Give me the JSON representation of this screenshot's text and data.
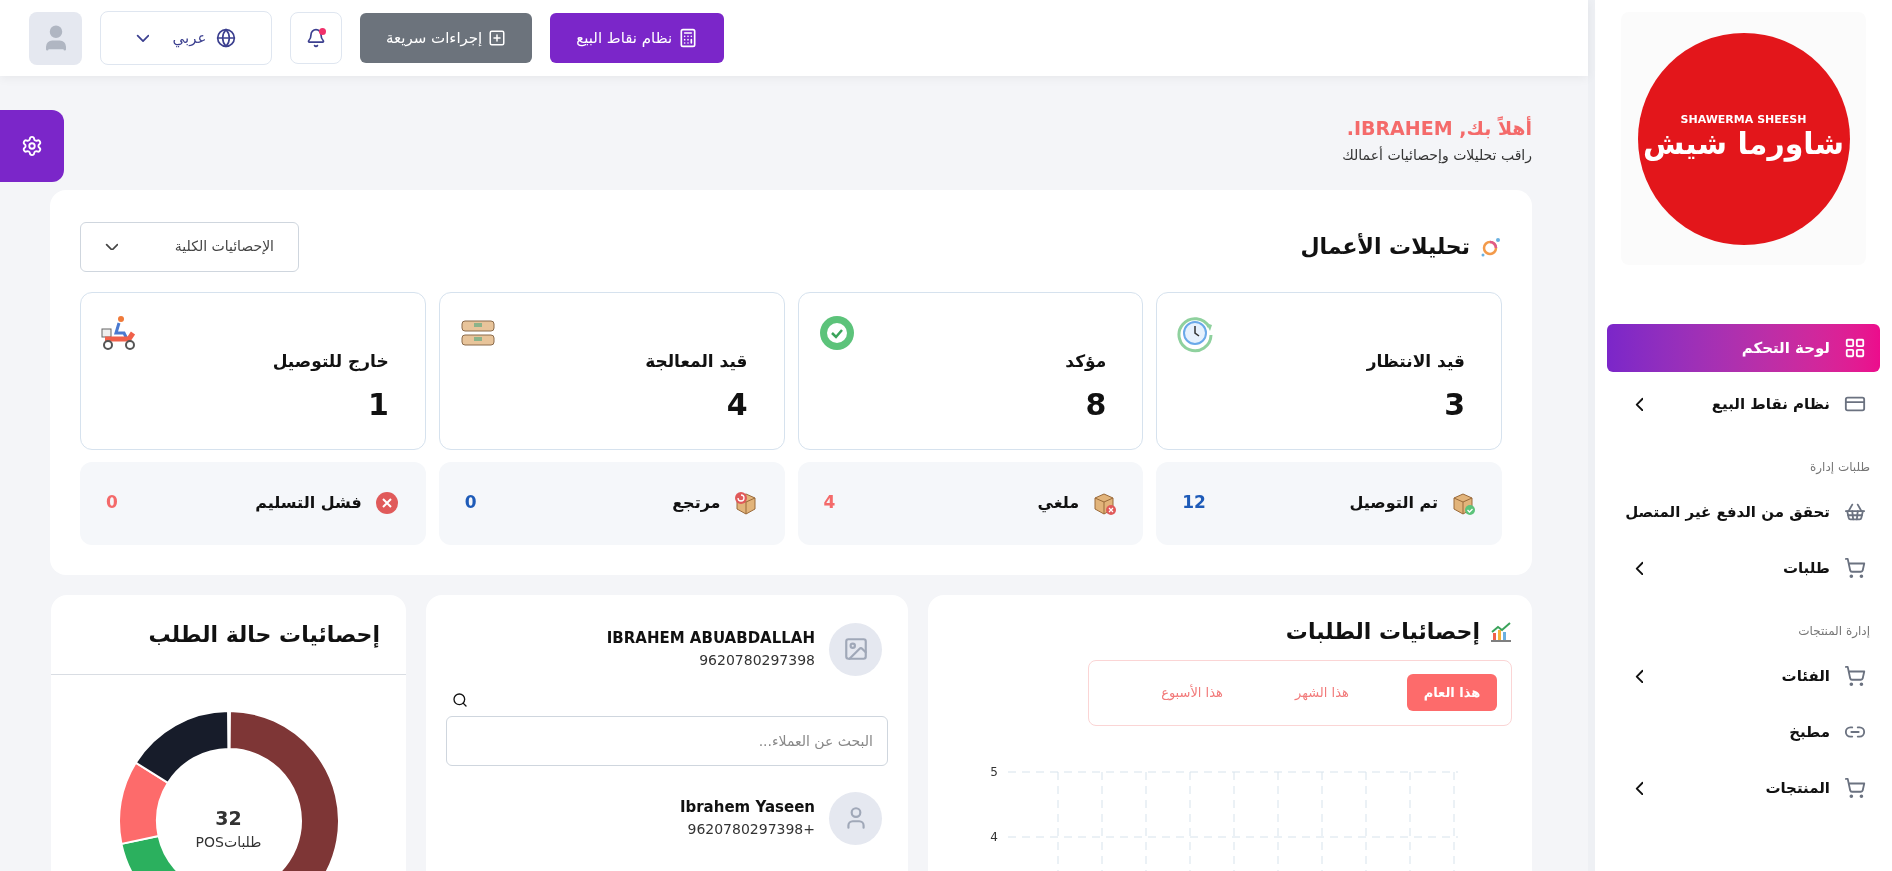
{
  "logo": {
    "script": "شاورما شيش",
    "latin": "SHAWERMA SHEESH"
  },
  "sidebar": {
    "items": [
      {
        "kind": "link",
        "label": "لوحة التحكم",
        "selected": true,
        "has_submenu": false
      },
      {
        "kind": "link",
        "label": "نظام نقاط البيع",
        "selected": false,
        "has_submenu": true
      },
      {
        "kind": "section",
        "label": "طلبات إدارة"
      },
      {
        "kind": "link",
        "label": "تحقق من الدفع غير المتصل",
        "selected": false,
        "has_submenu": false
      },
      {
        "kind": "link",
        "label": "طلبات",
        "selected": false,
        "has_submenu": true
      },
      {
        "kind": "section",
        "label": "إدارة المنتجات"
      },
      {
        "kind": "link",
        "label": "الفئات",
        "selected": false,
        "has_submenu": true
      },
      {
        "kind": "link",
        "label": "مطبخ",
        "selected": false,
        "has_submenu": false
      },
      {
        "kind": "link",
        "label": "المنتجات",
        "selected": false,
        "has_submenu": true
      }
    ]
  },
  "header": {
    "pos_button": "نظام نقاط البيع",
    "quick_actions_button": "إجراءات سريعة",
    "notifications": {
      "unread": true
    },
    "language": "عربي"
  },
  "greeting": {
    "title": "أهلاً بك, IBRAHEM.",
    "subtitle": "راقب تحليلات وإحصائيات أعمالك"
  },
  "analytics": {
    "title": "تحليلات الأعمال",
    "period_select": "الإحصائيات الكلية",
    "main_stats": [
      {
        "label": "قيد الانتظار",
        "value": "3"
      },
      {
        "label": "مؤكد",
        "value": "8"
      },
      {
        "label": "قيد المعالجة",
        "value": "4"
      },
      {
        "label": "خارج للتوصيل",
        "value": "1"
      }
    ],
    "secondary_stats": [
      {
        "label": "تم التوصيل",
        "value": "12",
        "color": "#1e5bb8"
      },
      {
        "label": "ملغي",
        "value": "4",
        "color": "#f46a6a"
      },
      {
        "label": "مرتجع",
        "value": "0",
        "color": "#1e5bb8"
      },
      {
        "label": "فشل التسليم",
        "value": "0",
        "color": "#f46a6a"
      }
    ]
  },
  "order_stats": {
    "title": "إحصائيات الطلبات",
    "tabs": [
      {
        "label": "هذا العام",
        "selected": true
      },
      {
        "label": "هذا الشهر",
        "selected": false
      },
      {
        "label": "هذا الأسبوع",
        "selected": false
      }
    ],
    "y_tick_labels": [
      "5",
      "4"
    ]
  },
  "customers": {
    "search_placeholder": "البحث عن العملاء...",
    "list": [
      {
        "name": "IBRAHEM ABUABDALLAH",
        "phone": "9620780297398"
      },
      {
        "name": "Ibrahem Yaseen",
        "phone": "+9620780297398"
      }
    ]
  },
  "order_status": {
    "title": "إحصائيات حالة الطلب",
    "total": "32",
    "total_label": "طلباتPOS"
  }
}
